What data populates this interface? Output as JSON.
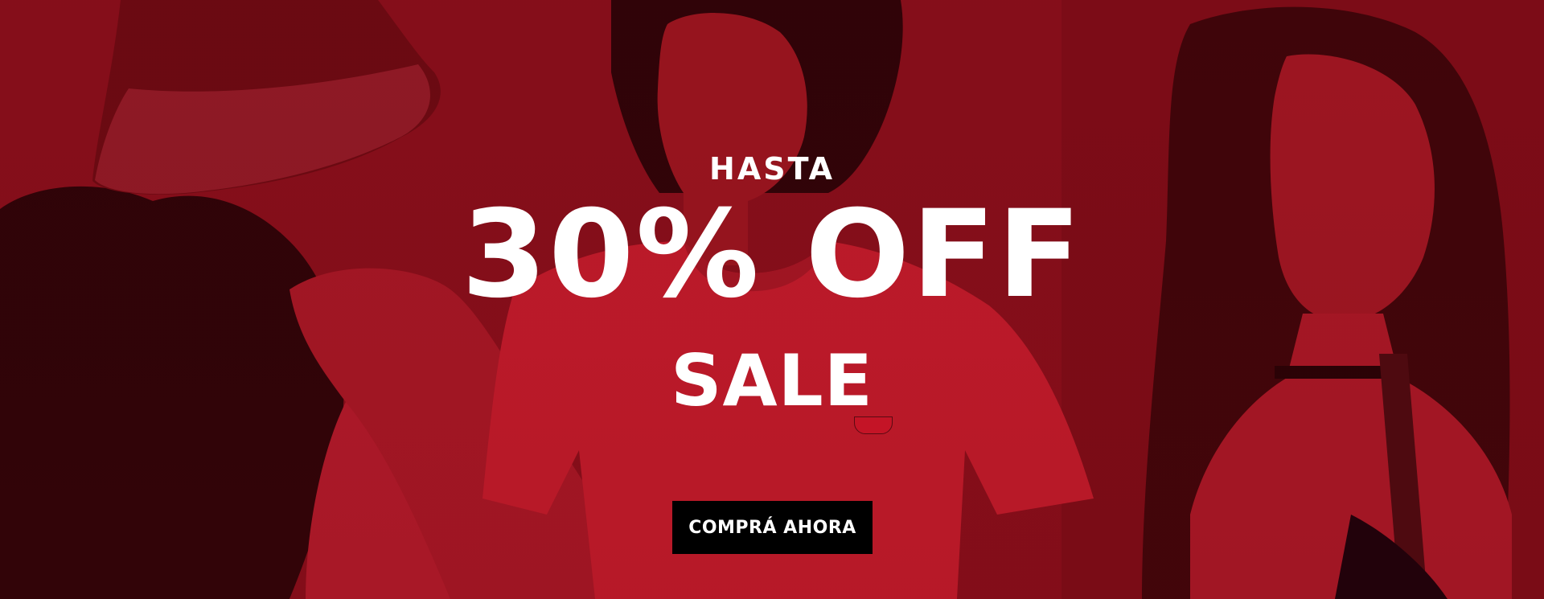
{
  "banner": {
    "eyebrow": "HASTA",
    "headline": "30% OFF",
    "subheadline": "SALE",
    "cta_label": "COMPRÁ AHORA"
  },
  "colors": {
    "background": "#8a0f1b",
    "cta_background": "#000000",
    "text": "#ffffff"
  }
}
